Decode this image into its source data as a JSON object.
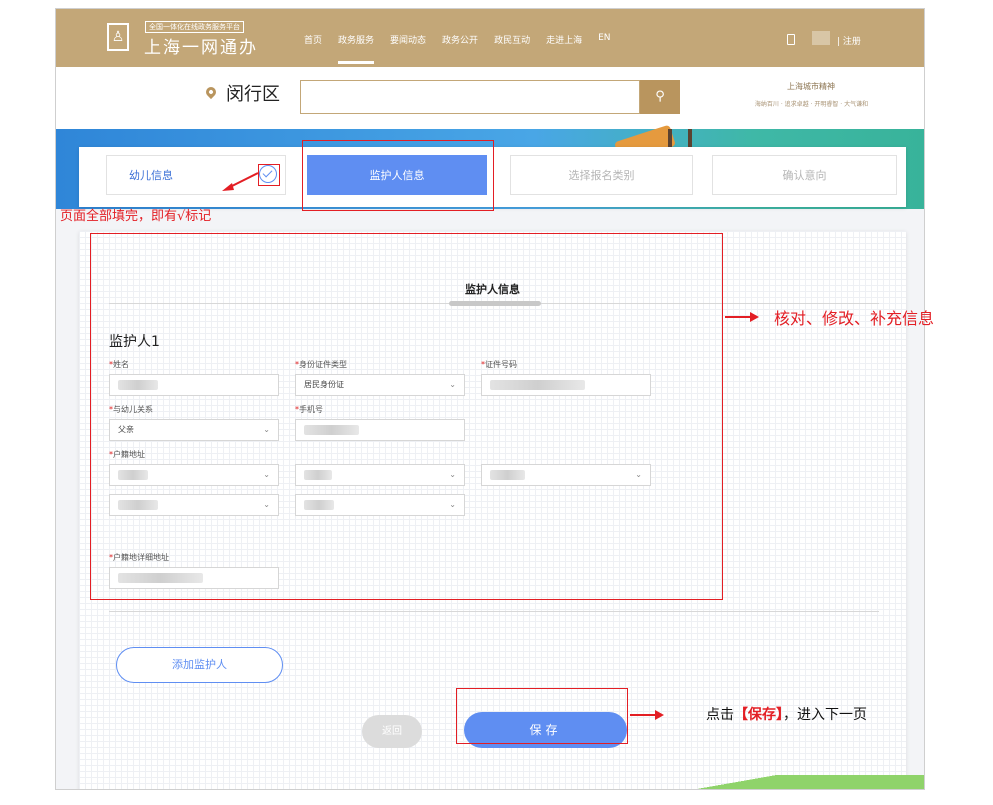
{
  "topbar": {
    "logo_icon": "person-emblem",
    "logo_tag": "全国一体化在线政务服务平台",
    "logo_name": "上海一网通办",
    "nav": [
      "首页",
      "政务服务",
      "要闻动态",
      "政务公开",
      "政民互动",
      "走进上海",
      "EN"
    ],
    "active_nav": "政务服务",
    "register": "| 注册"
  },
  "search": {
    "location": "闵行区",
    "placeholder": "",
    "button_icon": "search-icon",
    "spirit_title": "上海城市精神",
    "spirit_sub": "海纳百川 · 追求卓越 · 开明睿智 · 大气谦和"
  },
  "steps": [
    {
      "label": "幼儿信息",
      "state": "done"
    },
    {
      "label": "监护人信息",
      "state": "active"
    },
    {
      "label": "选择报名类别",
      "state": "pending"
    },
    {
      "label": "确认意向",
      "state": "pending"
    }
  ],
  "form": {
    "section_title": "监护人信息",
    "guardian_label": "监护人1",
    "fields": {
      "name": {
        "label": "姓名",
        "value": ""
      },
      "id_type": {
        "label": "身份证件类型",
        "value": "居民身份证"
      },
      "id_number": {
        "label": "证件号码",
        "value": ""
      },
      "relation": {
        "label": "与幼儿关系",
        "value": "父亲"
      },
      "phone": {
        "label": "手机号",
        "value": ""
      },
      "household": {
        "label": "户籍地址"
      },
      "household_detail": {
        "label": "户籍地详细地址",
        "value": ""
      }
    },
    "add_guardian": "添加监护人",
    "back": "返回",
    "save": "保存"
  },
  "annotations": {
    "complete_note": "页面全部填完，即有√标记",
    "verify_note": "核对、修改、补充信息",
    "save_note_prefix": "点击",
    "save_note_bold": "【保存】",
    "save_note_suffix": "，进入下一页",
    "accent_color": "#e31e24"
  },
  "colors": {
    "brand_gold": "#c3a778",
    "primary_blue": "#5f8ef2"
  }
}
